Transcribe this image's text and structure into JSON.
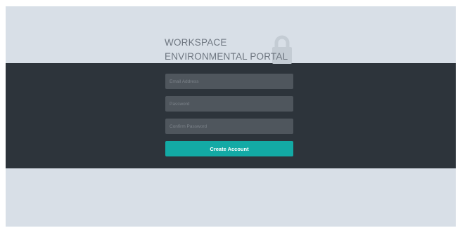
{
  "header": {
    "title_line1": "WORKSPACE",
    "title_line2": "ENVIRONMENTAL PORTAL",
    "icon": "lock-icon"
  },
  "form": {
    "email_placeholder": "Email Address",
    "email_value": "",
    "password_placeholder": "Password",
    "password_value": "",
    "confirm_placeholder": "Confirm Password",
    "confirm_value": "",
    "submit_label": "Create Account"
  },
  "colors": {
    "background": "#d8dfe7",
    "band": "#2d343b",
    "field": "#4f565d",
    "accent": "#13aaa5",
    "title": "#6e7680",
    "lock": "#c4ccd4"
  }
}
